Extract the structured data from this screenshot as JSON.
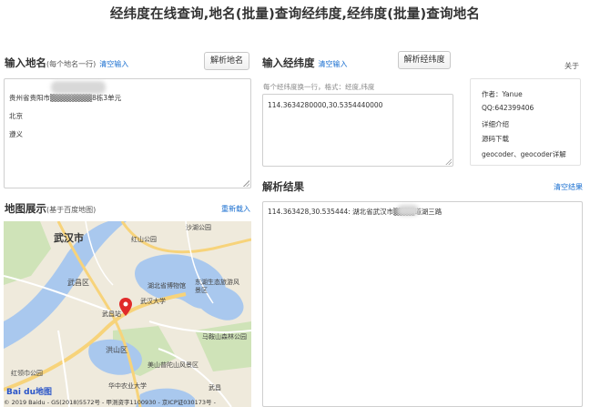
{
  "page": {
    "title": "经纬度在线查询,地名(批量)查询经纬度,经纬度(批量)查询地名"
  },
  "input_place": {
    "title": "输入地名",
    "hint": "(每个地名一行)",
    "clear_label": "清空输入",
    "parse_button": "解析地名",
    "lines": [
      "贵州省贵阳市▒▒▒▒▒▒▒▒8栋3单元",
      "北京",
      "遵义"
    ]
  },
  "input_coord": {
    "title": "输入经纬度",
    "clear_label": "清空输入",
    "parse_button": "解析经纬度",
    "placeholder_hint": "每个经纬度换一行，格式：经度,纬度",
    "value": "114.3634280000,30.5354440000"
  },
  "info_panel": {
    "about_label": "关于",
    "author": "作者：Yanue",
    "qq": "QQ:642399406",
    "detail_link": "详细介绍",
    "download_link": "源码下载",
    "geocoder_link": "geocoder、geocoder详解"
  },
  "map_section": {
    "title": "地图展示",
    "hint": "(基于百度地图)",
    "reload_label": "重新载入",
    "labels": {
      "wuhan": "武汉市",
      "hongshan_park": "红山公园",
      "wuchang_district": "武昌区",
      "hubei_museum": "湖北省博物馆",
      "wuhan_university": "武汉大学",
      "donghu": "东湖生态旅游风景区",
      "hongshan_district": "洪山区",
      "moshan": "马鞍山森林公园",
      "huazhong_agri": "华中农业大学",
      "shahu": "沙湖公园",
      "wuchang_station": "武昌站",
      "hongling": "红领巾公园",
      "mountain_scenic": "美山普陀山风景区",
      "wuchang_area": "武昌"
    },
    "baidu_logo": "Bai du地图",
    "copyright": "© 2019 Baidu - GS(2018)5572号 - 甲测资字1100930 - 京ICP证030173号 -"
  },
  "result_section": {
    "title": "解析结果",
    "clear_label": "清空结果",
    "result_text": "114.363428,30.535444: 湖北省武汉市▒▒▒▒道湖三路"
  },
  "colors": {
    "link": "#1a6fd0",
    "marker": "#e02a2a",
    "water": "#a9c8ee",
    "road": "#f7d37a"
  }
}
